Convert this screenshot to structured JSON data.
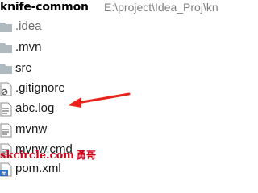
{
  "header": {
    "project_name": "knife-common",
    "project_path": "E:\\project\\Idea_Proj\\kn"
  },
  "tree": {
    "items": [
      {
        "label": ".idea",
        "icon": "folder-icon",
        "dim": true
      },
      {
        "label": ".mvn",
        "icon": "folder-icon",
        "dim": false
      },
      {
        "label": "src",
        "icon": "folder-icon",
        "dim": false
      },
      {
        "label": ".gitignore",
        "icon": "ignored-file-icon",
        "dim": false
      },
      {
        "label": "abc.log",
        "icon": "text-file-icon",
        "dim": false
      },
      {
        "label": "mvnw",
        "icon": "text-file-icon",
        "dim": false
      },
      {
        "label": "mvnw.cmd",
        "icon": "text-file-icon",
        "dim": false
      },
      {
        "label": "pom.xml",
        "icon": "maven-file-icon",
        "dim": false
      }
    ]
  },
  "watermark": {
    "text": "skcircle.com",
    "text_cn": "勇哥"
  },
  "colors": {
    "folder": "#aeb9c0",
    "annotation_arrow": "#e8221b",
    "watermark": "#d0021b",
    "maven_badge": "#2f6fc4"
  },
  "annotation": {
    "icon": "red-arrow-pointing-left"
  }
}
